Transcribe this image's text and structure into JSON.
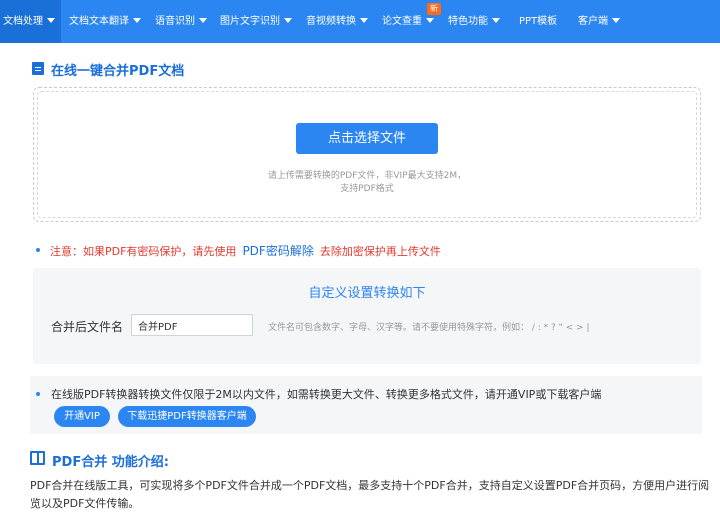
{
  "nav": {
    "items": [
      {
        "label": "文档处理",
        "caret": true
      },
      {
        "label": "文档文本翻译",
        "caret": true
      },
      {
        "label": "语音识别",
        "caret": true
      },
      {
        "label": "图片文字识别",
        "caret": true
      },
      {
        "label": "音视频转换",
        "caret": true
      },
      {
        "label": "论文查重",
        "caret": true
      },
      {
        "label": "特色功能",
        "caret": true
      },
      {
        "label": "PPT模板",
        "caret": false
      },
      {
        "label": "客户端",
        "caret": true
      }
    ],
    "new_badge": "新",
    "colors": {
      "bar": "#2b86f2",
      "active": "#1a6fd8",
      "badge": "#ff6a1a"
    }
  },
  "page": {
    "title": "在线一键合并PDF文档",
    "title_icon": "document-icon"
  },
  "upload": {
    "button_label": "点击选择文件",
    "hint_line1": "请上传需要转换的PDF文件，非VIP最大支持2M，",
    "hint_line2": "支持PDF格式"
  },
  "notice": {
    "prefix": "注意：如果PDF有密码保护，请先使用",
    "link": "PDF密码解除",
    "suffix": "去除加密保护再上传文件"
  },
  "settings": {
    "title": "自定义设置转换如下",
    "filename_label": "合并后文件名",
    "filename_value": "合并PDF",
    "filename_hint": "文件名可包含数字、字母、汉字等。请不要使用特殊字符，例如：  / : * ? \" < > |"
  },
  "vip": {
    "text": "在线版PDF转换器转换文件仅限于2M以内文件，如需转换更大文件、转换更多格式文件，请开通VIP或下载客户端",
    "open_vip_label": "开通VIP",
    "download_label": "下载迅捷PDF转换器客户端"
  },
  "intro": {
    "title": "PDF合并 功能介绍:",
    "title_icon": "book-icon",
    "body": "PDF合并在线版工具，可实现将多个PDF文件合并成一个PDF文档，最多支持十个PDF合并，支持自定义设置PDF合并页码，方便用户进行阅览以及PDF文件传输。"
  },
  "colors": {
    "primary": "#2b86f2",
    "notice": "#e03a2f",
    "panel": "#f5f6f8"
  }
}
